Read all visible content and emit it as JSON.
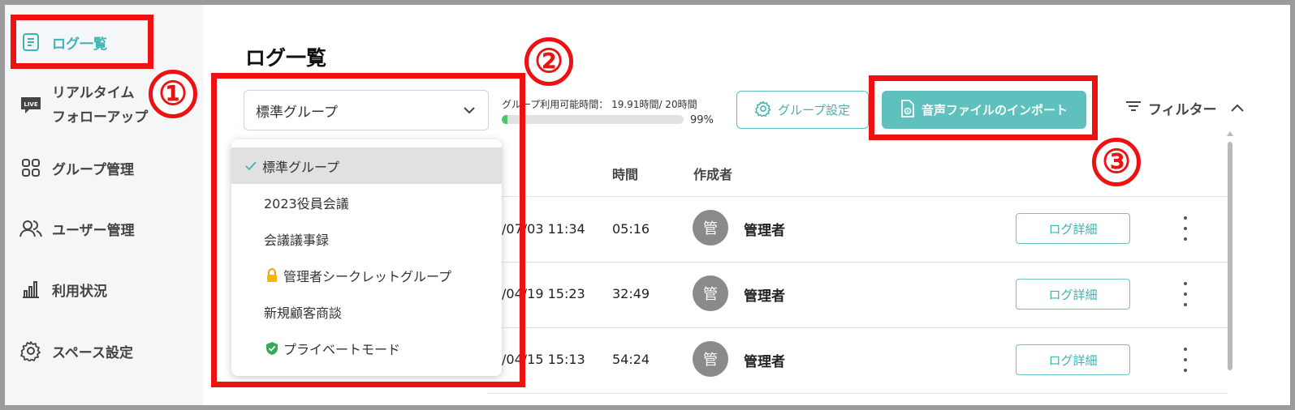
{
  "sidebar": {
    "items": [
      {
        "label": "ログ一覧",
        "icon": "document-list-icon",
        "active": true
      },
      {
        "label_line1": "リアルタイム",
        "label_line2": "フォローアップ",
        "icon": "live-icon",
        "badge_text": "LIVE"
      },
      {
        "label": "グループ管理",
        "icon": "grid-icon"
      },
      {
        "label": "ユーザー管理",
        "icon": "users-icon"
      },
      {
        "label": "利用状況",
        "icon": "bar-chart-icon"
      },
      {
        "label": "スペース設定",
        "icon": "gear-icon"
      }
    ]
  },
  "main": {
    "title": "ログ一覧",
    "group_select": {
      "value": "標準グループ"
    },
    "usage": {
      "label": "グループ利用可能時間： 19.91時間/ 20時間",
      "percent": 99,
      "percent_text": "99%"
    },
    "group_settings_button": "グループ設定",
    "import_button": "音声ファイルのインポート",
    "filter_label": "フィルター",
    "table": {
      "headers": {
        "time": "時間",
        "creator": "作成者"
      },
      "rows": [
        {
          "date_fragment": "/07/03 11:34",
          "duration": "05:16",
          "avatar": "管",
          "creator": "管理者",
          "detail": "ログ詳細"
        },
        {
          "date_fragment": "/04/19 15:23",
          "duration": "32:49",
          "avatar": "管",
          "creator": "管理者",
          "detail": "ログ詳細"
        },
        {
          "date_fragment": "/04/15 15:13",
          "duration": "54:24",
          "avatar": "管",
          "creator": "管理者",
          "detail": "ログ詳細"
        }
      ]
    }
  },
  "dropdown": {
    "items": [
      {
        "label": "標準グループ",
        "selected": true,
        "icon": "check-icon"
      },
      {
        "label": "2023役員会議"
      },
      {
        "label": "会議議事録"
      },
      {
        "label": "管理者シークレットグループ",
        "icon": "lock-icon"
      },
      {
        "label": "新規顧客商談"
      },
      {
        "label": "プライベートモード",
        "icon": "shield-check-icon"
      }
    ]
  },
  "annotations": [
    "①",
    "②",
    "③"
  ],
  "colors": {
    "accent": "#3fb3b0",
    "primary_button": "#5ec1bd",
    "annotation_red": "#ee1111",
    "progress": "#4fc46a"
  }
}
